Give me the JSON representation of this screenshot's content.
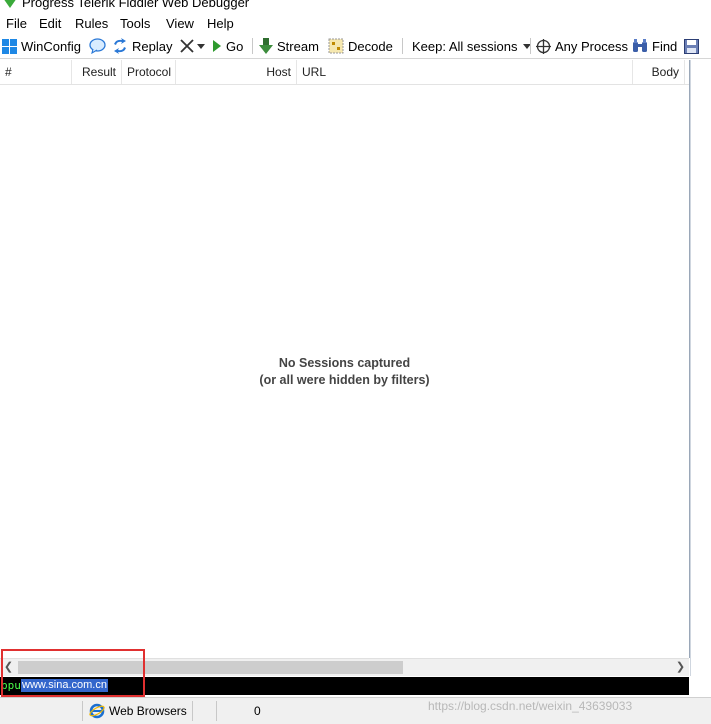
{
  "window": {
    "title": "Progress Telerik Fiddler Web Debugger"
  },
  "menu": [
    "File",
    "Edit",
    "Rules",
    "Tools",
    "View",
    "Help"
  ],
  "toolbar": {
    "winconfig": "WinConfig",
    "replay": "Replay",
    "go": "Go",
    "stream": "Stream",
    "decode": "Decode",
    "keep": "Keep: All sessions",
    "any_process": "Any Process",
    "find": "Find"
  },
  "columns": [
    "#",
    "Result",
    "Protocol",
    "Host",
    "URL",
    "Body"
  ],
  "empty_message": {
    "line1": "No Sessions captured",
    "line2": "(or all were hidden by filters)"
  },
  "quickexec": {
    "prompt": "ppu",
    "value": "www.sina.com.cn"
  },
  "status": {
    "capture_filter": "Web Browsers",
    "session_count": "0"
  },
  "watermark": "https://blog.csdn.net/weixin_43639033",
  "colors": {
    "accent_blue": "#1e6fd9",
    "quickexec_bg": "#000000",
    "selection": "#3366cc",
    "highlight_box": "#e03030"
  }
}
